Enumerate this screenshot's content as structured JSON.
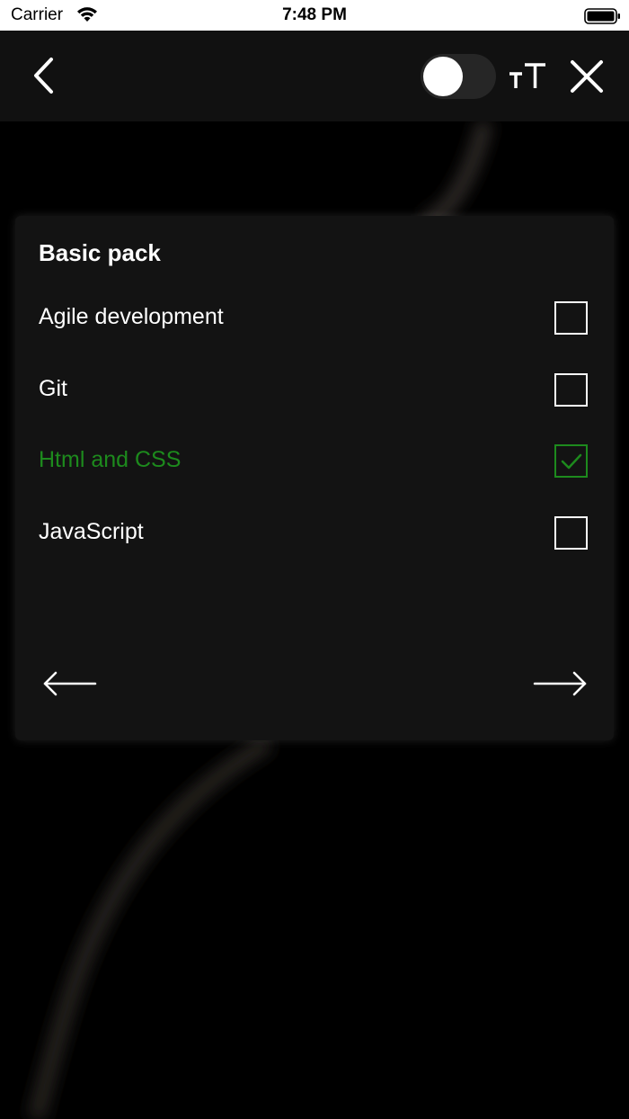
{
  "status_bar": {
    "carrier": "Carrier",
    "time": "7:48 PM"
  },
  "nav": {
    "back_icon": "chevron-left-icon",
    "theme_toggle": {
      "on": false
    },
    "text_size_icon": "text-size-icon",
    "close_icon": "close-icon"
  },
  "card": {
    "title": "Basic pack",
    "options": [
      {
        "label": "Agile development",
        "checked": false
      },
      {
        "label": "Git",
        "checked": false
      },
      {
        "label": "Html and CSS",
        "checked": true
      },
      {
        "label": "JavaScript",
        "checked": false
      }
    ],
    "prev_icon": "arrow-left-icon",
    "next_icon": "arrow-right-icon"
  },
  "colors": {
    "background": "#000000",
    "card": "#131313",
    "nav": "#111111",
    "selected": "#1d8a1d",
    "text": "#ffffff"
  }
}
